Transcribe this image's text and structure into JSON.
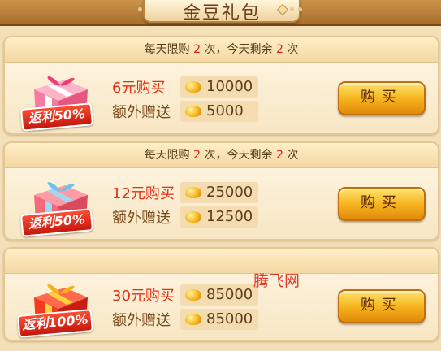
{
  "header": {
    "title": "金豆礼包"
  },
  "packages": [
    {
      "limit_prefix": "每天限购",
      "limit_total": "2",
      "limit_middle": "次，今天剩余",
      "limit_remaining": "2",
      "limit_suffix": "次",
      "badge": "返利50%",
      "price_label": "6元购买",
      "price_amount": "10000",
      "bonus_label": "额外赠送",
      "bonus_amount": "5000",
      "button": "购买",
      "gift_color": "#f47ca3"
    },
    {
      "limit_prefix": "每天限购",
      "limit_total": "2",
      "limit_middle": "次，今天剩余",
      "limit_remaining": "2",
      "limit_suffix": "次",
      "badge": "返利50%",
      "price_label": "12元购买",
      "price_amount": "25000",
      "bonus_label": "额外赠送",
      "bonus_amount": "12500",
      "button": "购买",
      "gift_color": "#f26a7c"
    },
    {
      "badge": "返利100%",
      "price_label": "30元购买",
      "price_amount": "85000",
      "bonus_label": "额外赠送",
      "bonus_amount": "85000",
      "button": "购买",
      "gift_color": "#f23a22"
    }
  ],
  "watermark": "腾飞网",
  "colors": {
    "accent_red": "#e02020",
    "button_gold": "#f6b01b",
    "panel": "#f7e6c3"
  },
  "icons": {
    "coin": "gold-bean-icon",
    "gift": "gift-box-icon"
  }
}
